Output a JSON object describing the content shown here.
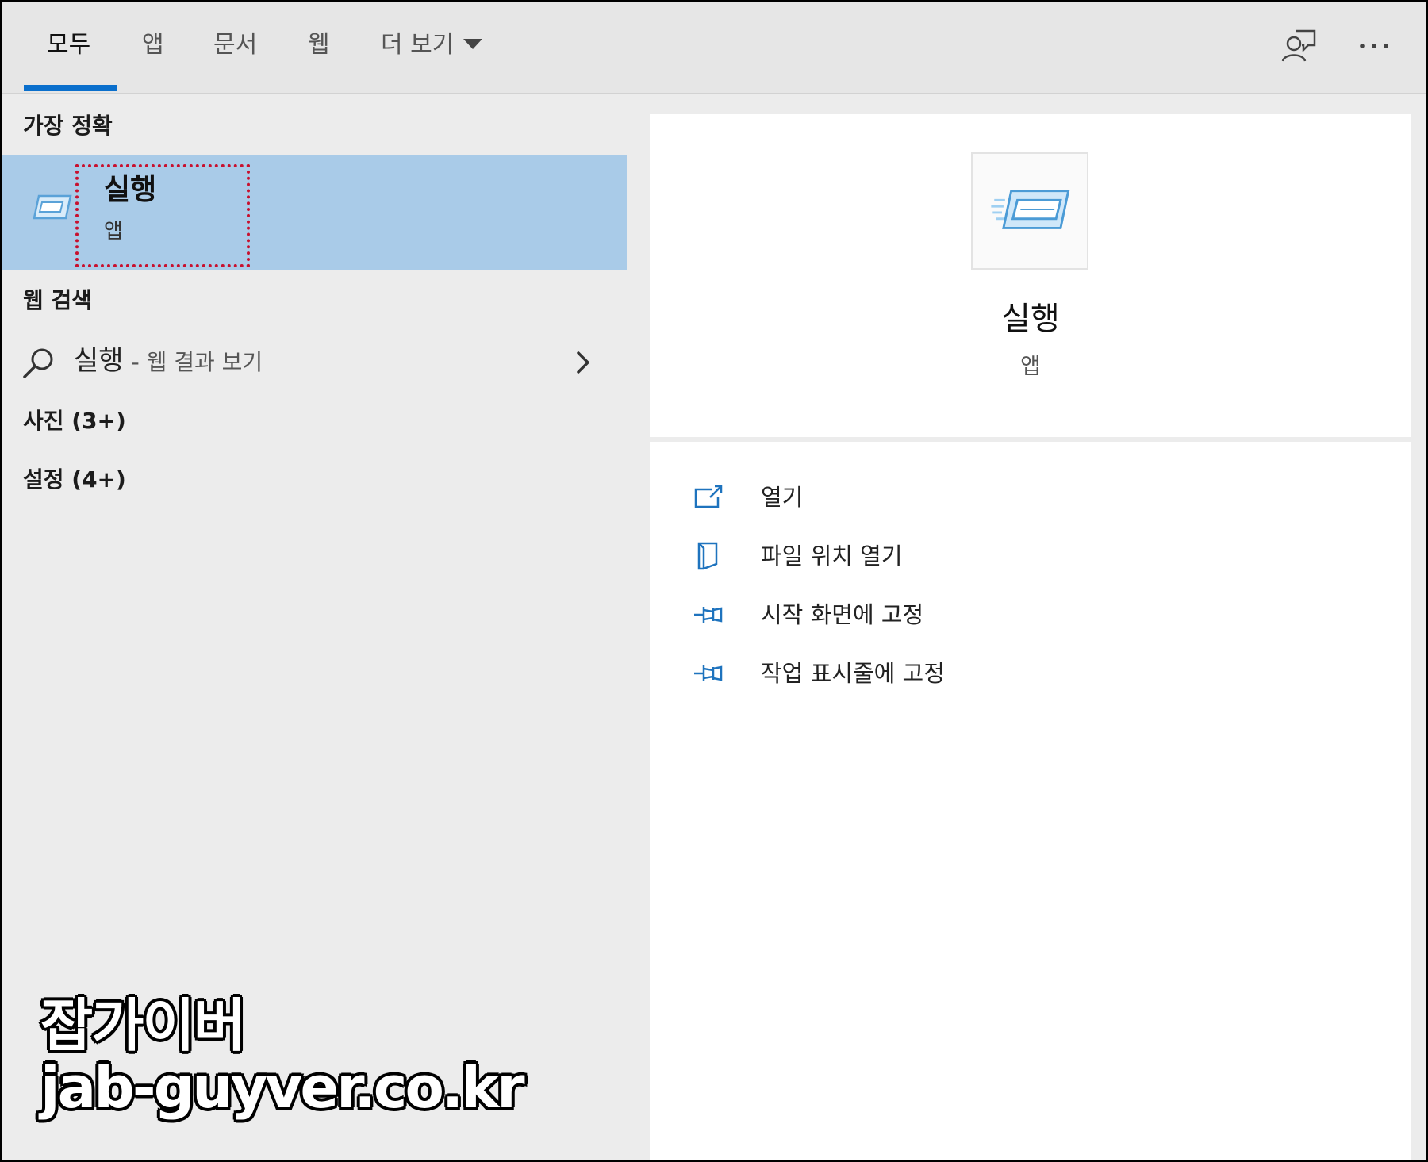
{
  "tabs": [
    {
      "label": "모두",
      "active": true
    },
    {
      "label": "앱"
    },
    {
      "label": "문서"
    },
    {
      "label": "웹"
    },
    {
      "label": "더 보기"
    }
  ],
  "toolbar": {
    "feedback_icon": "feedback-icon",
    "more_icon": "more-icon"
  },
  "left": {
    "best_match_header": "가장 정확",
    "best_match": {
      "title": "실행",
      "subtitle": "앱",
      "icon": "run-app-icon"
    },
    "web_header": "웹 검색",
    "web_result": {
      "query": "실행",
      "suffix": "- 웹 결과 보기"
    },
    "photos": "사진 (3+)",
    "settings": "설정 (4+)"
  },
  "detail": {
    "app_name": "실행",
    "app_type": "앱",
    "actions": [
      {
        "label": "열기",
        "icon": "open-icon"
      },
      {
        "label": "파일 위치 열기",
        "icon": "file-location-icon"
      },
      {
        "label": "시작 화면에 고정",
        "icon": "pin-icon"
      },
      {
        "label": "작업 표시줄에 고정",
        "icon": "pin-icon"
      }
    ]
  },
  "watermark": {
    "line1": "잡가이버",
    "line2": "jab-guyver.co.kr"
  },
  "colors": {
    "accent": "#0a6fcc",
    "selected": "#a9cbe8",
    "highlight_box": "#c8102e"
  }
}
